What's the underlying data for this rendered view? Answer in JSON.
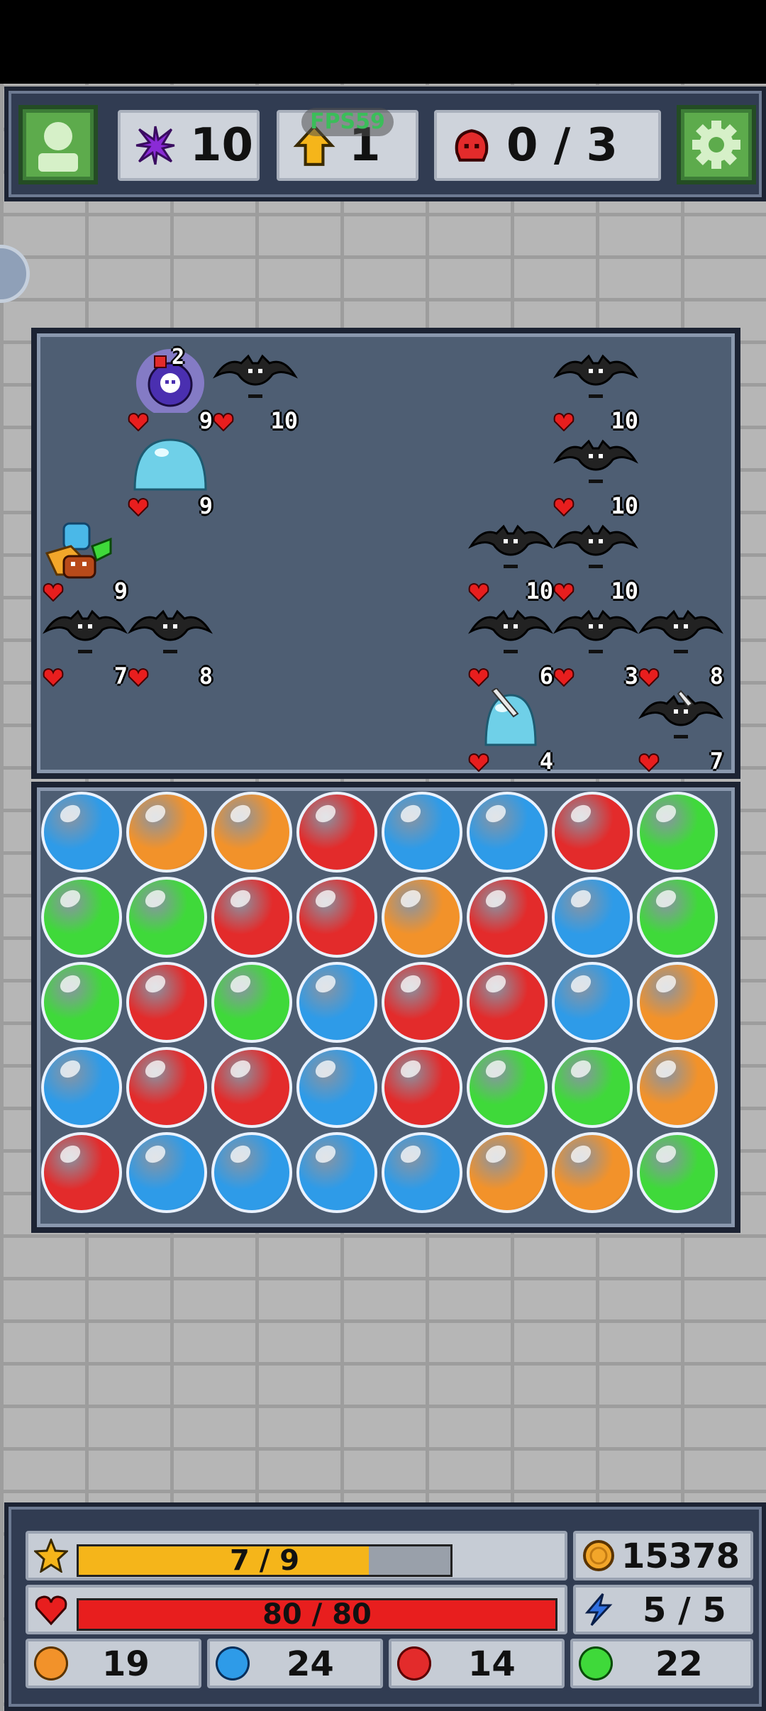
{
  "hud": {
    "crystals": "10",
    "level": "1",
    "enemies_progress": "0 / 3",
    "fps": "FPS59"
  },
  "battle": {
    "units": [
      {
        "kind": "hero-knight",
        "hp": "9"
      },
      {
        "kind": "ghost-orb",
        "hp": "9",
        "badge": "2"
      },
      {
        "kind": "bat",
        "hp": "10"
      },
      {
        "kind": "bat",
        "hp": "10"
      },
      {
        "kind": "slime-blue",
        "hp": "9"
      },
      {
        "kind": "bat",
        "hp": "10"
      },
      {
        "kind": "bat",
        "hp": "10"
      },
      {
        "kind": "bat",
        "hp": "10"
      },
      {
        "kind": "bat",
        "hp": "7"
      },
      {
        "kind": "bat",
        "hp": "8"
      },
      {
        "kind": "bat",
        "hp": "6"
      },
      {
        "kind": "bat",
        "hp": "3"
      },
      {
        "kind": "bat",
        "hp": "8"
      },
      {
        "kind": "slime-blue-sword",
        "hp": "4"
      },
      {
        "kind": "bat-sword",
        "hp": "7"
      }
    ]
  },
  "board": {
    "rows": [
      [
        "blue",
        "orange",
        "orange",
        "red",
        "blue",
        "blue",
        "red",
        "green"
      ],
      [
        "green",
        "green",
        "red",
        "red",
        "orange",
        "red",
        "blue",
        "green"
      ],
      [
        "green",
        "red",
        "green",
        "blue",
        "red",
        "red",
        "blue",
        "orange"
      ],
      [
        "blue",
        "red",
        "red",
        "blue",
        "red",
        "green",
        "green",
        "orange"
      ],
      [
        "red",
        "blue",
        "blue",
        "blue",
        "blue",
        "orange",
        "orange",
        "green"
      ]
    ],
    "colors": {
      "blue": "#2e9be8",
      "orange": "#f2922a",
      "red": "#e32b2b",
      "green": "#3fd93a"
    }
  },
  "status": {
    "xp_text": "7 / 9",
    "xp_fraction": 0.78,
    "hp_text": "80 / 80",
    "hp_fraction": 1.0,
    "gold": "15378",
    "mana": "5 / 5",
    "orb_counts": {
      "orange": "19",
      "blue": "24",
      "red": "14",
      "green": "22"
    }
  },
  "theme": {
    "xp_color": "#f5b51a",
    "hp_color": "#e81e1e",
    "button_green": "#5dab4c"
  }
}
